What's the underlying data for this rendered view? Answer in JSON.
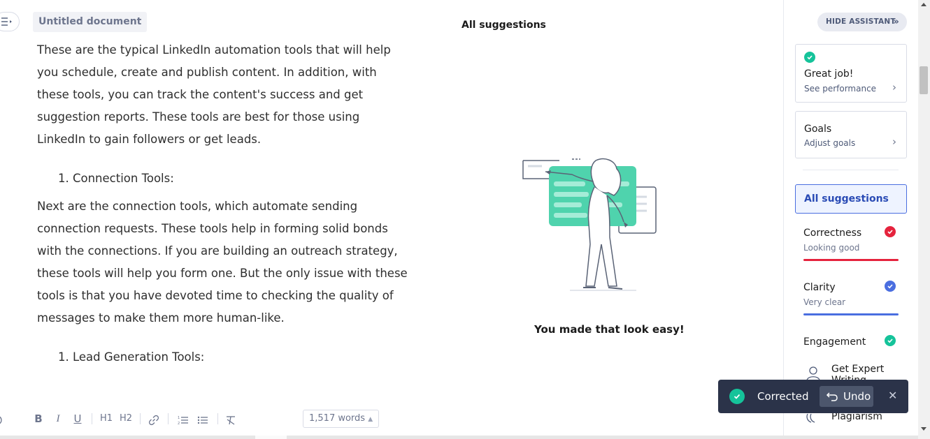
{
  "document": {
    "title": "Untitled document",
    "paragraph1": [
      "These are the typical LinkedIn automation tools that will help",
      "you schedule, create and publish content. In addition, with",
      "these tools, you can track the content's success and get",
      "suggestion reports. These tools are best for those using",
      "LinkedIn to gain followers or get leads."
    ],
    "list_item1": "1.  Connection Tools:",
    "paragraph2": [
      "Next are the connection tools, which automate sending",
      "connection requests. These tools help in forming solid bonds",
      "with the connections. If you are building an outreach strategy,",
      "these tools will help you form one. But the only issue with these",
      "tools is that you have devoted time to checking the quality of",
      "messages to make them more human-like."
    ],
    "list_item2": "1.  Lead Generation Tools:"
  },
  "toolbar": {
    "bold": "B",
    "italic": "I",
    "underline": "U",
    "h1": "H1",
    "h2": "H2",
    "word_count": "1,517 words"
  },
  "center": {
    "heading": "All suggestions",
    "message": "You made that look easy!"
  },
  "sidebar": {
    "hide_assistant": "HIDE ASSISTANT",
    "great_job_title": "Great job!",
    "great_job_sub": "See performance",
    "goals_title": "Goals",
    "goals_sub": "Adjust goals",
    "all_suggestions": "All suggestions",
    "categories": [
      {
        "title": "Correctness",
        "sub": "Looking good",
        "color": "#e5233d"
      },
      {
        "title": "Clarity",
        "sub": "Very clear",
        "color": "#4a6ee0"
      },
      {
        "title": "Engagement",
        "sub": "",
        "color": "#15c39a"
      }
    ],
    "expert_help": "Get Expert Writing Help",
    "plagiarism": "Plagiarism"
  },
  "toast": {
    "message": "Corrected",
    "undo": "Undo"
  },
  "colors": {
    "accent_green": "#15c39a",
    "accent_blue": "#4a6ee0",
    "accent_red": "#e5233d",
    "toast_bg": "#2b3349"
  }
}
